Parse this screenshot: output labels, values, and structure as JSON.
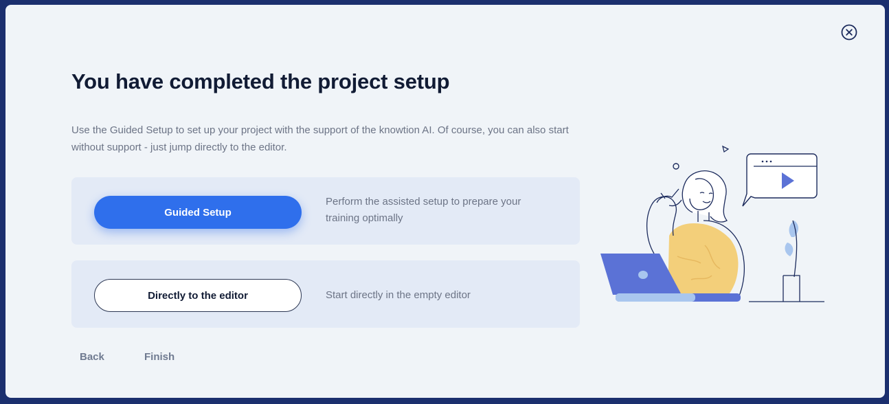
{
  "dialog": {
    "title": "You have completed the project setup",
    "description": "Use the Guided Setup to set up your project with the support of the knowtion AI. Of course, you can also start without support - just jump directly to the editor.",
    "close_icon": "close-circle-icon"
  },
  "options": [
    {
      "button_label": "Guided Setup",
      "description": "Perform the assisted setup to prepare your training optimally"
    },
    {
      "button_label": "Directly to the editor",
      "description": "Start directly in the empty editor"
    }
  ],
  "footer": {
    "back_label": "Back",
    "finish_label": "Finish"
  },
  "colors": {
    "primary": "#2f6fec",
    "background": "#f0f4f8",
    "backdrop": "#1b2f6e",
    "card": "#e3eaf6",
    "title": "#111b34",
    "text_muted": "#6c7486"
  }
}
